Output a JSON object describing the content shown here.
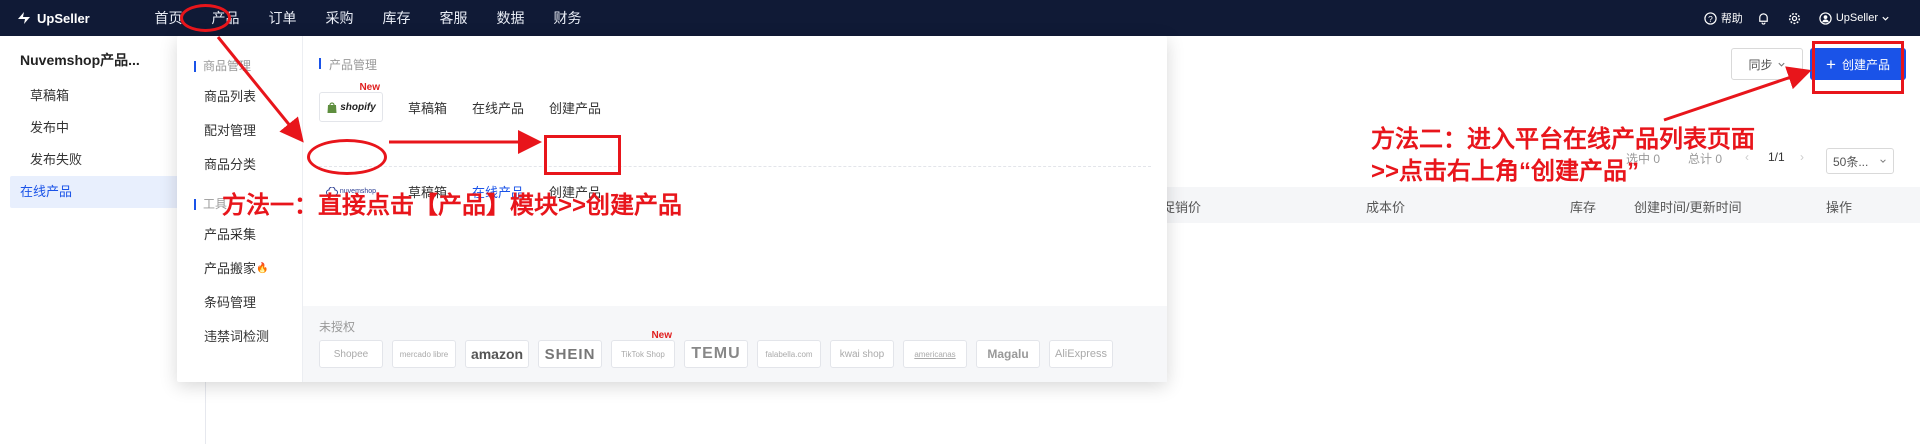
{
  "topbar": {
    "logo": "UpSeller",
    "nav": [
      "首页",
      "产品",
      "订单",
      "采购",
      "库存",
      "客服",
      "数据",
      "财务"
    ],
    "help": "帮助",
    "user": "UpSeller"
  },
  "sidebar": {
    "title": "Nuvemshop产品...",
    "items": [
      "草稿箱",
      "发布中",
      "发布失败",
      "在线产品"
    ]
  },
  "main": {
    "sync_label": "同步",
    "create_label": "创建产品",
    "selected_label": "选中 0",
    "total_label": "总计 0",
    "page_label": "1/1",
    "page_size": "50条...",
    "columns": {
      "price": "促销价",
      "cost": "成本价",
      "stock": "库存",
      "time": "创建时间/更新时间",
      "action": "操作"
    }
  },
  "popup": {
    "left": {
      "section1": "商品管理",
      "items1": [
        "商品列表",
        "配对管理",
        "商品分类"
      ],
      "section2": "工具",
      "items2": [
        "产品采集",
        "产品搬家",
        "条码管理",
        "违禁词检测"
      ]
    },
    "right": {
      "title": "产品管理",
      "shopify": {
        "logo": "shopify",
        "badge": "New",
        "links": [
          "草稿箱",
          "在线产品",
          "创建产品"
        ]
      },
      "nuvemshop": {
        "logo": "nuvemshop",
        "links": [
          "草稿箱",
          "在线产品",
          "创建产品"
        ]
      },
      "unauthorized_title": "未授权",
      "unauthorized": [
        "Shopee",
        "mercado libre",
        "amazon",
        "SHEIN",
        "TikTok Shop",
        "TEMU",
        "falabella.com",
        "kwai shop",
        "americanas",
        "Magalu",
        "AliExpress"
      ],
      "tiktok_badge": "New"
    }
  },
  "annotations": {
    "method1": "方法一：直接点击【产品】模块>>创建产品",
    "method2_line1": "方法二：进入平台在线产品列表页面",
    "method2_line2": ">>点击右上角“创建产品”"
  },
  "colors": {
    "nav_bg": "#101a36",
    "accent": "#1a53e8",
    "annotation_red": "#e8151b"
  }
}
